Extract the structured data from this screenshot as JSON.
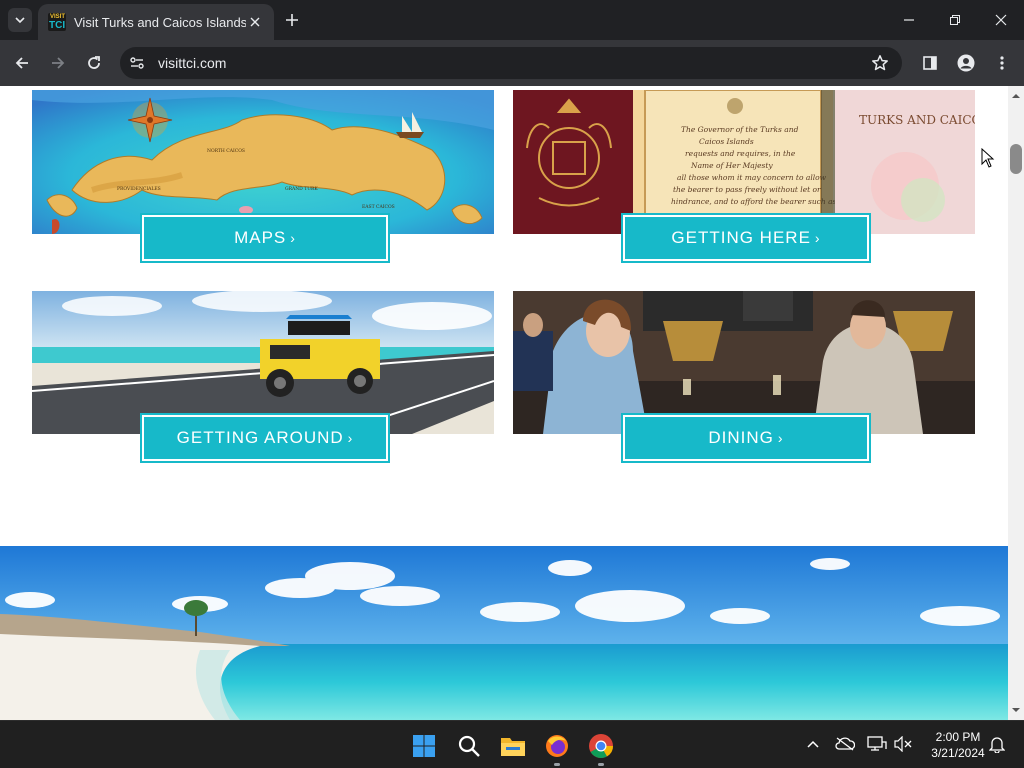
{
  "browser": {
    "tab_title": "Visit Turks and Caicos Islands",
    "favicon_top": "VISIT",
    "favicon_bottom": "TCI",
    "url": "visittci.com"
  },
  "cards": [
    {
      "label": "MAPS",
      "chevron": "›",
      "photo": "watercolor map of Turks and Caicos"
    },
    {
      "label": "GETTING HERE",
      "chevron": "›",
      "photo": "passport covers and governor's request page"
    },
    {
      "label": "GETTING AROUND",
      "chevron": "›",
      "photo": "yellow jeep with kayak on coastal road"
    },
    {
      "label": "DINING",
      "chevron": "›",
      "photo": "couple dining in restaurant"
    }
  ],
  "map_labels": [
    "NORTH CAICOS",
    "PROVIDENCIALES",
    "EAST CAICOS",
    "GRAND TURK"
  ],
  "passport_text": {
    "right_cover": "TURKS AND CAICOS",
    "request": "The Governor of the Turks and Caicos Islands requests and requires, in the Name of Her Majesty"
  },
  "taskbar": {
    "time": "2:00 PM",
    "date": "3/21/2024"
  },
  "colors": {
    "cta": "#17b9c9",
    "chrome_dark": "#202124",
    "chrome_toolbar": "#35363a"
  }
}
